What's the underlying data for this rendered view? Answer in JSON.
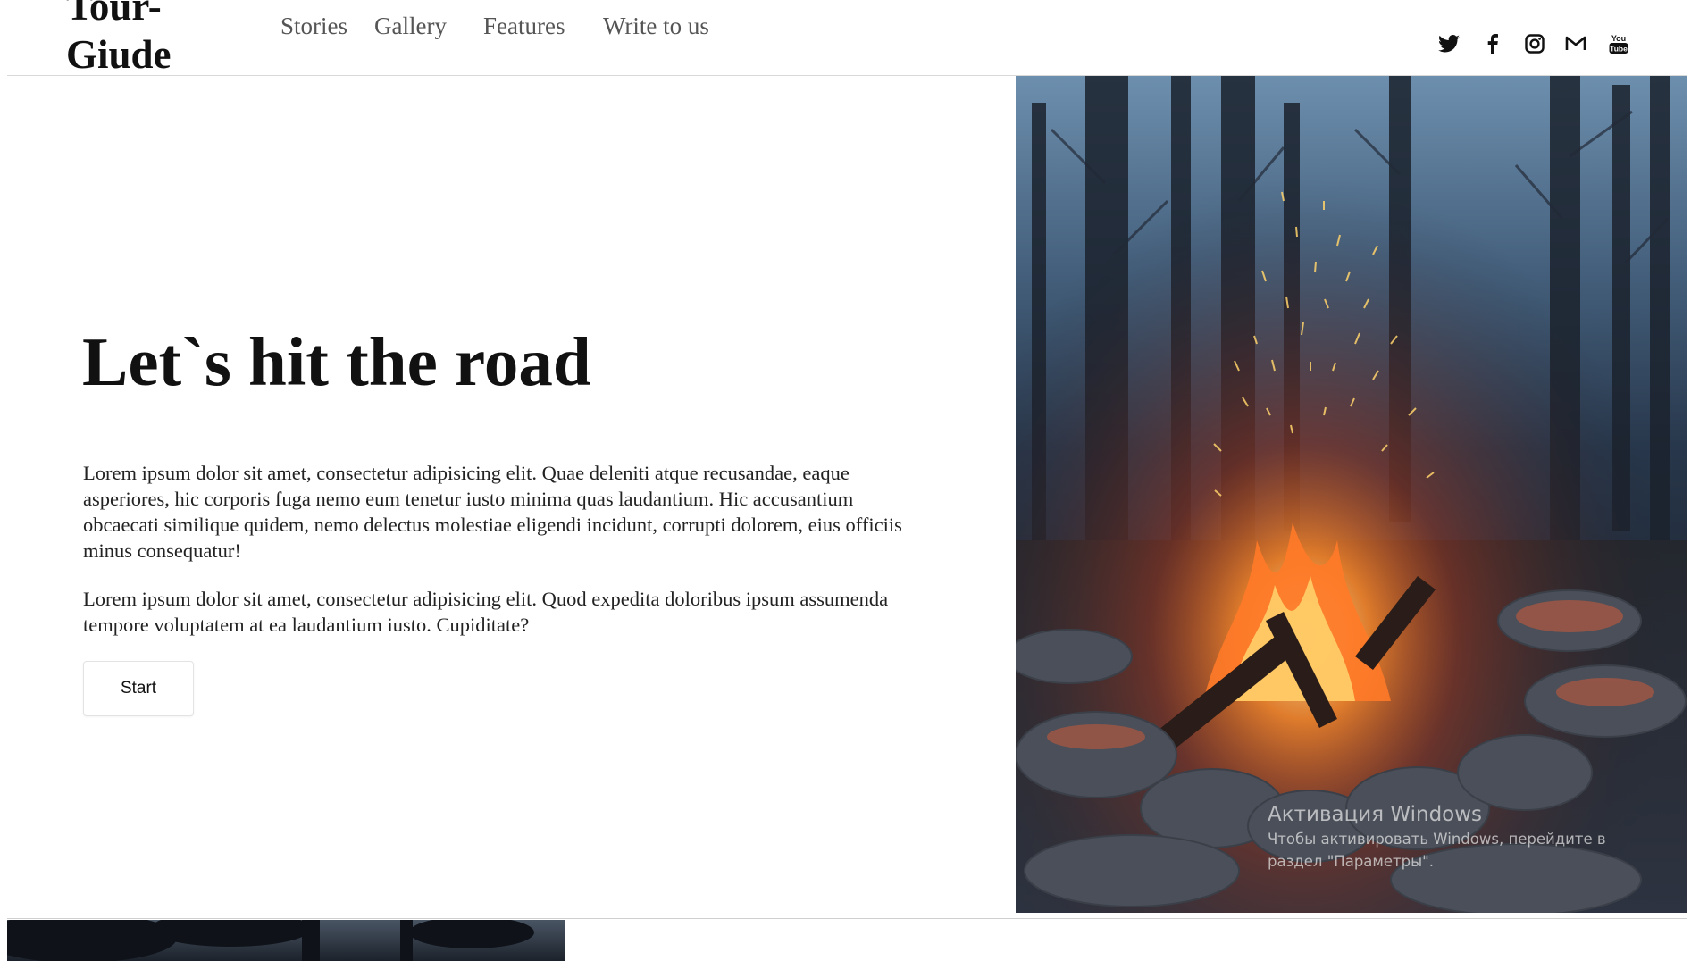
{
  "header": {
    "logo": "Tour-Giude",
    "nav": [
      "Stories",
      "Gallery",
      "Features",
      "Write to us"
    ],
    "social": [
      {
        "icon": "twitter-icon"
      },
      {
        "icon": "facebook-icon"
      },
      {
        "icon": "instagram-icon"
      },
      {
        "icon": "mail-icon"
      },
      {
        "icon": "youtube-icon"
      }
    ]
  },
  "hero": {
    "title": "Let`s hit the road",
    "paragraph_1": "Lorem ipsum dolor sit amet, consectetur adipisicing elit. Quae deleniti atque recusandae, eaque asperiores, hic corporis fuga nemo eum tenetur iusto minima quas laudantium. Hic accusantium obcaecati similique quidem, nemo delectus molestiae eligendi incidunt, corrupti dolorem, eius officiis minus consequatur!",
    "paragraph_2": "Lorem ipsum dolor sit amet, consectetur adipisicing elit. Quod expedita doloribus ipsum assumenda tempore voluptatem at ea laudantium iusto. Cupiditate?",
    "start_label": "Start"
  },
  "os_watermark": {
    "title": "Активация Windows",
    "text": "Чтобы активировать Windows, перейдите в раздел \"Параметры\"."
  }
}
